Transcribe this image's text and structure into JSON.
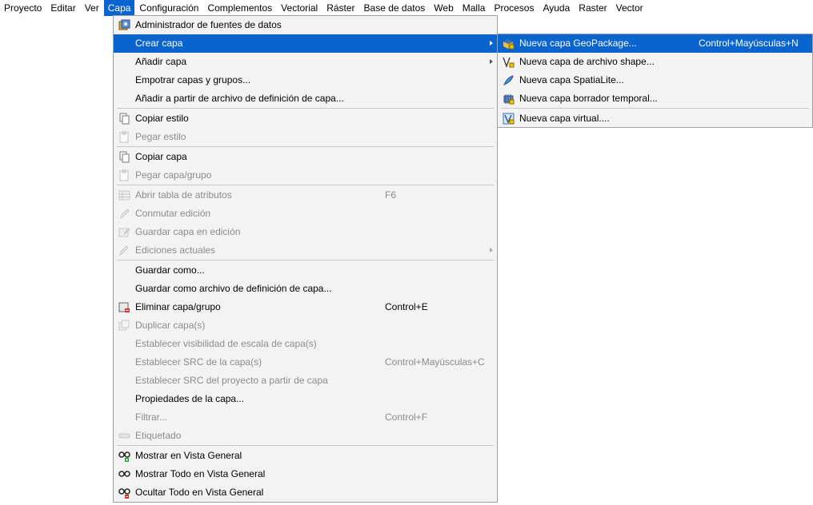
{
  "menubar": {
    "items": [
      "Proyecto",
      "Editar",
      "Ver",
      "Capa",
      "Configuración",
      "Complementos",
      "Vectorial",
      "Ráster",
      "Base de datos",
      "Web",
      "Malla",
      "Procesos",
      "Ayuda",
      "Raster",
      "Vector"
    ]
  },
  "capa_menu": {
    "items": [
      {
        "label": "Administrador de fuentes de datos",
        "icon": "data-source-manager-icon"
      },
      {
        "label": "Crear capa",
        "icon": "none",
        "submenu": true
      },
      {
        "label": "Añadir capa",
        "icon": "none",
        "submenu": true
      },
      {
        "label": "Empotrar capas y grupos...",
        "icon": "none"
      },
      {
        "label": "Añadir a partir de archivo de definición de capa...",
        "icon": "none"
      },
      {
        "label": "Copiar estilo",
        "icon": "copy-icon"
      },
      {
        "label": "Pegar estilo",
        "icon": "paste-icon"
      },
      {
        "label": "Copiar capa",
        "icon": "copy-icon"
      },
      {
        "label": "Pegar capa/grupo",
        "icon": "paste-icon"
      },
      {
        "label": "Abrir tabla de atributos",
        "shortcut": "F6",
        "icon": "table-icon"
      },
      {
        "label": "Conmutar edición",
        "icon": "pencil-icon"
      },
      {
        "label": "Guardar capa en edición",
        "icon": "save-edits-icon"
      },
      {
        "label": "Ediciones actuales",
        "icon": "edits-icon",
        "submenu": true
      },
      {
        "label": "Guardar como...",
        "icon": "none"
      },
      {
        "label": "Guardar como archivo de definición de capa...",
        "icon": "none"
      },
      {
        "label": "Eliminar capa/grupo",
        "shortcut": "Control+E",
        "icon": "remove-layer-icon"
      },
      {
        "label": "Duplicar capa(s)",
        "icon": "duplicate-icon"
      },
      {
        "label": "Establecer visibilidad de escala de capa(s)",
        "icon": "none"
      },
      {
        "label": "Establecer SRC de la capa(s)",
        "shortcut": "Control+Mayúsculas+C",
        "icon": "none"
      },
      {
        "label": "Establecer SRC del proyecto a partir de capa",
        "icon": "none"
      },
      {
        "label": "Propiedades de la capa...",
        "icon": "none"
      },
      {
        "label": "Filtrar...",
        "shortcut": "Control+F",
        "icon": "none"
      },
      {
        "label": "Etiquetado",
        "icon": "label-icon"
      },
      {
        "label": "Mostrar en Vista General",
        "icon": "overview-add-icon"
      },
      {
        "label": "Mostrar Todo en Vista General",
        "icon": "overview-icon"
      },
      {
        "label": "Ocultar Todo en Vista General",
        "icon": "overview-remove-icon"
      }
    ]
  },
  "crear_capa_submenu": {
    "items": [
      {
        "label": "Nueva capa GeoPackage...",
        "shortcut": "Control+Mayúsculas+N",
        "icon": "geopackage-icon"
      },
      {
        "label": "Nueva capa de archivo shape...",
        "icon": "shapefile-icon"
      },
      {
        "label": "Nueva capa SpatiaLite...",
        "icon": "spatialite-icon"
      },
      {
        "label": "Nueva capa borrador temporal...",
        "icon": "scratch-layer-icon"
      },
      {
        "label": "Nueva capa virtual....",
        "icon": "virtual-layer-icon"
      }
    ]
  },
  "colors": {
    "highlight": "#0a64d0",
    "disabled_text": "#8c8c8c",
    "menu_bg": "#f3f3f3"
  }
}
